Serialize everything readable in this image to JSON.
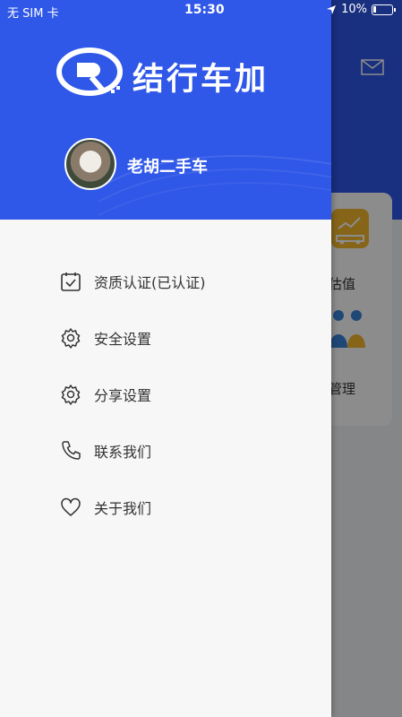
{
  "status_bar": {
    "carrier": "无 SIM 卡",
    "time": "15:30",
    "battery": "10%"
  },
  "app": {
    "name": "结行车加"
  },
  "user": {
    "name": "老胡二手车"
  },
  "menu": [
    {
      "label": "资质认证(已认证)",
      "icon": "calendar-check-icon"
    },
    {
      "label": "安全设置",
      "icon": "gear-icon"
    },
    {
      "label": "分享设置",
      "icon": "gear-icon"
    },
    {
      "label": "联系我们",
      "icon": "phone-icon"
    },
    {
      "label": "关于我们",
      "icon": "heart-icon"
    }
  ],
  "background": {
    "tile1_label": "况估值",
    "tile2_label": "客管理"
  },
  "colors": {
    "brand_blue": "#2f57e8",
    "tile_yellow": "#f5b82e",
    "tile_blue": "#3b83d8"
  }
}
